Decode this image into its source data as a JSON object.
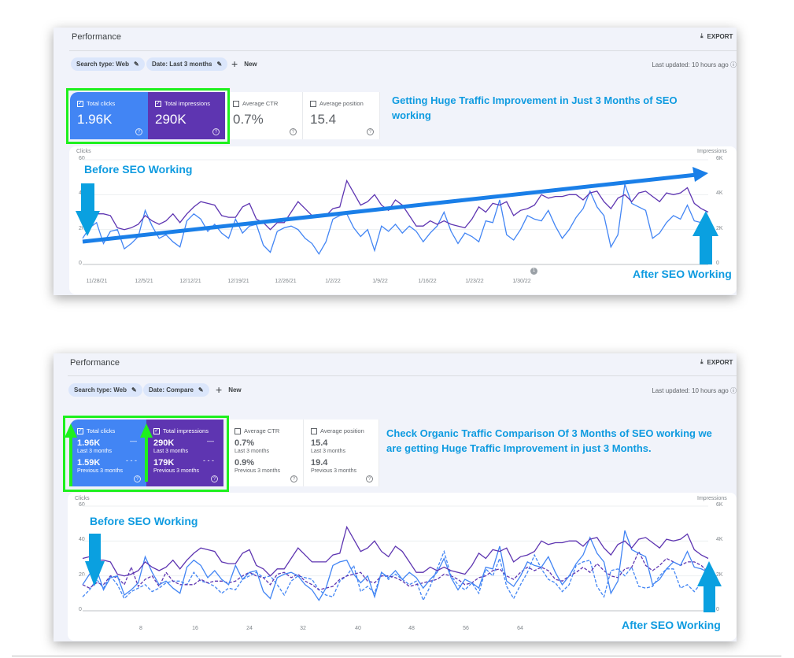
{
  "colors": {
    "clicks": "#4285f4",
    "impressions": "#5e35b1",
    "annotation": "#0f9be0",
    "highlight": "#1ef01e",
    "trend_arrow": "#1a7fe8"
  },
  "top": {
    "title": "Performance",
    "export_label": "EXPORT",
    "filters": [
      {
        "label": "Search type: Web"
      },
      {
        "label": "Date: Last 3 months"
      }
    ],
    "new_label": "New",
    "last_updated": "Last updated: 10 hours ago",
    "cards": [
      {
        "label": "Total clicks",
        "value": "1.96K",
        "checked": true
      },
      {
        "label": "Total impressions",
        "value": "290K",
        "checked": true
      },
      {
        "label": "Average CTR",
        "value": "0.7%",
        "checked": false
      },
      {
        "label": "Average position",
        "value": "15.4",
        "checked": false
      }
    ],
    "annotation": "Getting Huge Traffic Improvement in Just 3 Months of SEO working",
    "before_label": "Before SEO Working",
    "after_label": "After SEO Working",
    "annotation_marker": "1",
    "chart_data": {
      "type": "line",
      "left_axis_title": "Clicks",
      "right_axis_title": "Impressions",
      "left_ticks": [
        "60",
        "40",
        "20",
        "0"
      ],
      "right_ticks": [
        "6K",
        "4K",
        "2K",
        "0"
      ],
      "ylim_left": [
        0,
        60
      ],
      "ylim_right": [
        0,
        6000
      ],
      "x_ticks": [
        "11/28/21",
        "12/5/21",
        "12/12/21",
        "12/19/21",
        "12/26/21",
        "1/2/22",
        "1/9/22",
        "1/16/22",
        "1/23/22",
        "1/30/22"
      ],
      "series": [
        {
          "name": "Clicks",
          "axis": "left",
          "values": [
            15,
            21,
            24,
            12,
            19,
            20,
            9,
            12,
            16,
            31,
            22,
            15,
            17,
            13,
            10,
            25,
            29,
            26,
            19,
            23,
            18,
            15,
            26,
            18,
            22,
            23,
            11,
            7,
            19,
            21,
            22,
            20,
            15,
            12,
            6,
            13,
            26,
            28,
            29,
            21,
            16,
            20,
            8,
            22,
            19,
            23,
            18,
            22,
            19,
            13,
            18,
            22,
            30,
            19,
            12,
            18,
            16,
            13,
            25,
            24,
            37,
            17,
            14,
            20,
            28,
            26,
            25,
            31,
            22,
            15,
            20,
            27,
            32,
            42,
            33,
            28,
            10,
            17,
            46,
            35,
            33,
            31,
            15,
            18,
            24,
            28,
            26,
            34,
            25,
            24,
            22
          ]
        },
        {
          "name": "Impressions",
          "axis": "right",
          "values": [
            3000,
            3100,
            2900,
            2900,
            2800,
            2100,
            2000,
            2100,
            2300,
            2800,
            2500,
            2300,
            2500,
            2900,
            2400,
            2900,
            3300,
            3600,
            3500,
            3400,
            2800,
            2700,
            2700,
            3300,
            3500,
            2600,
            2400,
            2000,
            2400,
            2400,
            3000,
            3600,
            3200,
            2800,
            2800,
            2800,
            3200,
            3300,
            4800,
            4100,
            3400,
            3600,
            4000,
            3400,
            3100,
            3700,
            3400,
            2800,
            2200,
            2200,
            2500,
            2300,
            2500,
            2300,
            2200,
            2100,
            2600,
            3300,
            3000,
            3500,
            3400,
            3600,
            2800,
            3100,
            3200,
            3400,
            4000,
            3800,
            3900,
            3900,
            4000,
            4000,
            3700,
            4100,
            4200,
            3600,
            3200,
            3800,
            4000,
            3600,
            4100,
            4200,
            3900,
            3600,
            4100,
            4000,
            4100,
            4400,
            3500,
            3200,
            3000
          ]
        }
      ]
    }
  },
  "bottom": {
    "title": "Performance",
    "export_label": "EXPORT",
    "filters": [
      {
        "label": "Search type: Web"
      },
      {
        "label": "Date: Compare"
      }
    ],
    "new_label": "New",
    "last_updated": "Last updated: 10 hours ago",
    "cards": [
      {
        "label": "Total clicks",
        "current": "1.96K",
        "current_period": "Last 3 months",
        "previous": "1.59K",
        "previous_period": "Previous 3 months",
        "checked": true
      },
      {
        "label": "Total impressions",
        "current": "290K",
        "current_period": "Last 3 months",
        "previous": "179K",
        "previous_period": "Previous 3 months",
        "checked": true
      },
      {
        "label": "Average CTR",
        "current": "0.7%",
        "current_period": "Last 3 months",
        "previous": "0.9%",
        "previous_period": "Previous 3 months",
        "checked": false
      },
      {
        "label": "Average position",
        "current": "15.4",
        "current_period": "Last 3 months",
        "previous": "19.4",
        "previous_period": "Previous 3 months",
        "checked": false
      }
    ],
    "annotation": "Check Organic Traffic Comparison Of 3 Months of SEO working we are getting Huge Traffic Improvement in just 3 Months.",
    "before_label": "Before SEO Working",
    "after_label": "After SEO Working",
    "chart_data": {
      "type": "line",
      "left_axis_title": "Clicks",
      "right_axis_title": "Impressions",
      "left_ticks": [
        "60",
        "40",
        "20",
        "0"
      ],
      "right_ticks": [
        "6K",
        "4K",
        "2K",
        "0"
      ],
      "ylim_left": [
        0,
        60
      ],
      "ylim_right": [
        0,
        6000
      ],
      "x_ticks": [
        "8",
        "16",
        "24",
        "32",
        "40",
        "48",
        "56",
        "64"
      ],
      "series": [
        {
          "name": "Clicks (Last 3 months)",
          "axis": "left",
          "style": "solid",
          "values": [
            15,
            21,
            24,
            12,
            19,
            20,
            9,
            12,
            16,
            31,
            22,
            15,
            17,
            13,
            10,
            25,
            29,
            26,
            19,
            23,
            18,
            15,
            26,
            18,
            22,
            23,
            11,
            7,
            19,
            21,
            22,
            20,
            15,
            12,
            6,
            13,
            26,
            28,
            29,
            21,
            16,
            20,
            8,
            22,
            19,
            23,
            18,
            22,
            19,
            13,
            18,
            22,
            30,
            19,
            12,
            18,
            16,
            13,
            25,
            24,
            37,
            17,
            14,
            20,
            28,
            26,
            25,
            31,
            22,
            15,
            20,
            27,
            32,
            42,
            33,
            28,
            10,
            17,
            46,
            35,
            33,
            31,
            15,
            18,
            24,
            28,
            26,
            34,
            25,
            24,
            22
          ]
        },
        {
          "name": "Impressions (Last 3 months)",
          "axis": "right",
          "style": "solid",
          "values": [
            3000,
            3100,
            2900,
            2900,
            2800,
            2100,
            2000,
            2100,
            2300,
            2800,
            2500,
            2300,
            2500,
            2900,
            2400,
            2900,
            3300,
            3600,
            3500,
            3400,
            2800,
            2700,
            2700,
            3300,
            3500,
            2600,
            2400,
            2000,
            2400,
            2400,
            3000,
            3600,
            3200,
            2800,
            2800,
            2800,
            3200,
            3300,
            4800,
            4100,
            3400,
            3600,
            4000,
            3400,
            3100,
            3700,
            3400,
            2800,
            2200,
            2200,
            2500,
            2300,
            2500,
            2300,
            2200,
            2100,
            2600,
            3300,
            3000,
            3500,
            3400,
            3600,
            2800,
            3100,
            3200,
            3400,
            4000,
            3800,
            3900,
            3900,
            4000,
            4000,
            3700,
            4100,
            4200,
            3600,
            3200,
            3800,
            4000,
            3600,
            4100,
            4200,
            3900,
            3600,
            4100,
            4000,
            4100,
            4400,
            3500,
            3200,
            3000
          ]
        },
        {
          "name": "Clicks (Previous 3 months)",
          "axis": "left",
          "style": "dashed",
          "values": [
            8,
            12,
            18,
            13,
            20,
            15,
            7,
            11,
            13,
            15,
            11,
            13,
            16,
            17,
            17,
            15,
            22,
            17,
            16,
            14,
            10,
            13,
            12,
            18,
            20,
            22,
            19,
            20,
            15,
            9,
            17,
            20,
            19,
            18,
            12,
            9,
            8,
            17,
            20,
            26,
            11,
            14,
            10,
            22,
            18,
            21,
            18,
            15,
            17,
            6,
            14,
            24,
            34,
            20,
            15,
            12,
            16,
            10,
            24,
            20,
            30,
            14,
            7,
            15,
            22,
            32,
            24,
            18,
            16,
            11,
            15,
            26,
            28,
            29,
            14,
            8,
            23,
            24,
            20,
            25,
            14,
            13,
            14,
            20,
            24,
            24,
            13,
            15,
            11,
            16,
            14
          ]
        },
        {
          "name": "Impressions (Previous 3 months)",
          "axis": "right",
          "style": "dashed",
          "values": [
            1500,
            1300,
            1600,
            1500,
            2000,
            1900,
            1500,
            2500,
            1400,
            1800,
            2000,
            1400,
            2200,
            1700,
            1500,
            1500,
            1500,
            1800,
            1600,
            1700,
            1700,
            1600,
            1700,
            2000,
            2200,
            2000,
            1900,
            1500,
            2100,
            2200,
            1900,
            2100,
            1700,
            1500,
            1200,
            1300,
            1400,
            1800,
            2000,
            2100,
            2200,
            1700,
            1600,
            2000,
            2000,
            1900,
            1700,
            1400,
            1500,
            1600,
            1700,
            1800,
            2100,
            2000,
            1800,
            1500,
            1600,
            1900,
            2000,
            2300,
            2400,
            2000,
            1800,
            2200,
            2500,
            2300,
            2500,
            2300,
            1800,
            1700,
            2000,
            2200,
            2500,
            2200,
            2700,
            2300,
            2000,
            1900,
            2400,
            2500,
            3400,
            2600,
            2300,
            2600,
            3000,
            2800,
            2600,
            2800,
            2800,
            2600,
            2200
          ]
        }
      ]
    }
  }
}
